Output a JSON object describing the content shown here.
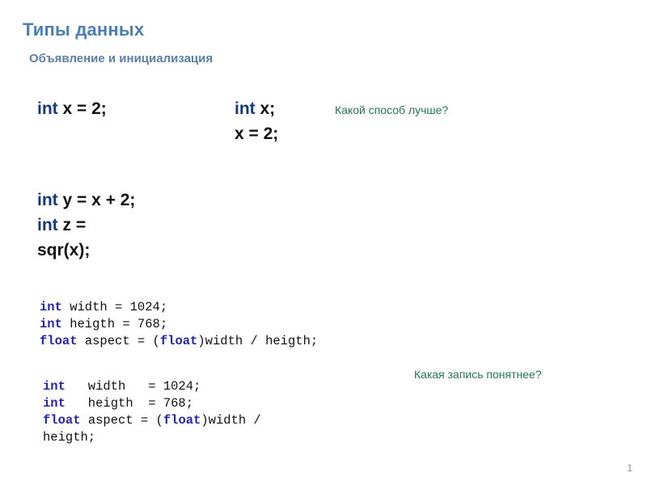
{
  "slide": {
    "title": "Типы данных",
    "subtitle": "Объявление и инициализация",
    "number": "1",
    "colors": {
      "title": "#4a7fb5",
      "subtitle": "#5b81a8",
      "keyword_prop": "#16397d",
      "keyword_mono": "#2424b0",
      "note": "#1f7a4e",
      "body_text": "#111111",
      "background": "#ffffff",
      "slide_number": "#8a8a8a"
    }
  },
  "code_blocks": {
    "block1": {
      "lines": [
        [
          {
            "t": "int",
            "k": true
          },
          {
            "t": " x = 2;",
            "k": false
          }
        ]
      ]
    },
    "block2": {
      "lines": [
        [
          {
            "t": "int",
            "k": true
          },
          {
            "t": " x;",
            "k": false
          }
        ],
        [
          {
            "t": "x = 2;",
            "k": false
          }
        ]
      ]
    },
    "block3": {
      "lines": [
        [
          {
            "t": "int",
            "k": true
          },
          {
            "t": " y = x + 2;",
            "k": false
          }
        ],
        [
          {
            "t": "int",
            "k": true
          },
          {
            "t": " z =",
            "k": false
          }
        ],
        [
          {
            "t": "sqr(x);",
            "k": false
          }
        ]
      ]
    },
    "block4": {
      "lines": [
        [
          {
            "t": "int",
            "k": true
          },
          {
            "t": " width = 1024;",
            "k": false
          }
        ],
        [
          {
            "t": "int",
            "k": true
          },
          {
            "t": " heigth = 768;",
            "k": false
          }
        ],
        [
          {
            "t": "float",
            "k": true
          },
          {
            "t": " aspect = (",
            "k": false
          },
          {
            "t": "float",
            "k": true
          },
          {
            "t": ")width / heigth;",
            "k": false
          }
        ]
      ]
    },
    "block5": {
      "lines": [
        [
          {
            "t": "int",
            "k": true
          },
          {
            "t": "   width   = 1024;",
            "k": false
          }
        ],
        [
          {
            "t": "int",
            "k": true
          },
          {
            "t": "   heigth  = 768;",
            "k": false
          }
        ],
        [
          {
            "t": "float",
            "k": true
          },
          {
            "t": " aspect = (",
            "k": false
          },
          {
            "t": "float",
            "k": true
          },
          {
            "t": ")width /",
            "k": false
          }
        ],
        [
          {
            "t": "heigth;",
            "k": false
          }
        ]
      ]
    }
  },
  "notes": {
    "note1": "Какой способ лучше?",
    "note2": "Какая запись понятнее?"
  }
}
